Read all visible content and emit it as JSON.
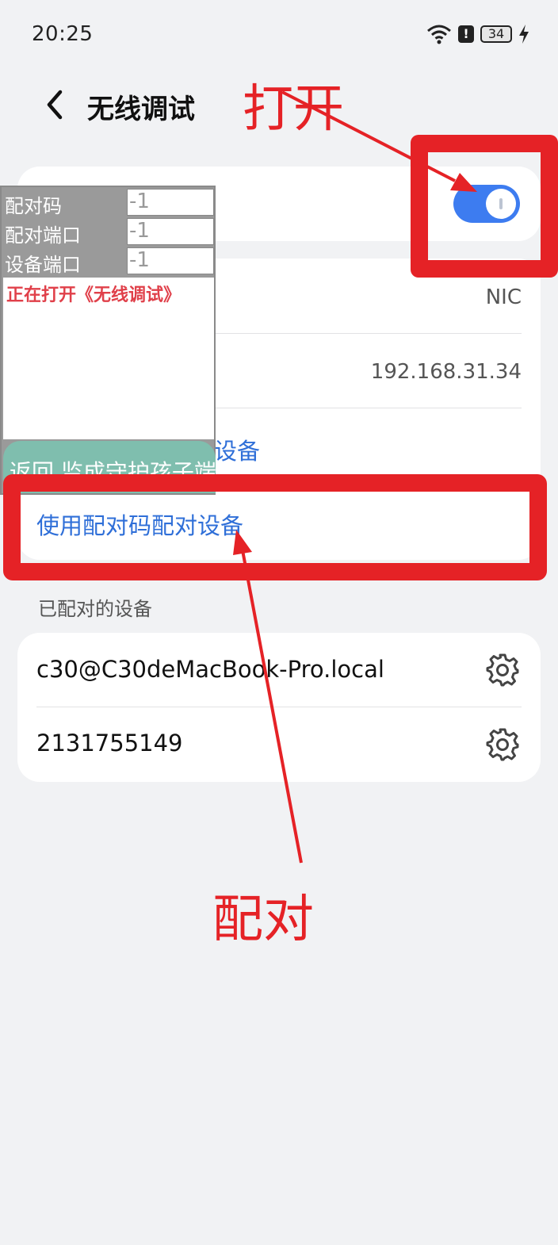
{
  "status_bar": {
    "time": "20:25",
    "battery": "34",
    "icons": [
      "wifi-icon",
      "alert-icon",
      "battery-icon",
      "charging-icon"
    ]
  },
  "header": {
    "title": "无线调试",
    "back_icon": "chevron-left-icon"
  },
  "toggle": {
    "state": "on",
    "accent": "#3d7cf0"
  },
  "info_rows": [
    {
      "value": "NIC"
    },
    {
      "value": "192.168.31.34"
    }
  ],
  "info_links": [
    {
      "label": "设备"
    },
    {
      "label": "使用配对码配对设备"
    }
  ],
  "paired_section": {
    "label": "已配对的设备",
    "devices": [
      {
        "name": "c30@C30deMacBook-Pro.local",
        "icon": "gear-icon"
      },
      {
        "name": "2131755149",
        "icon": "gear-icon"
      }
    ]
  },
  "overlay": {
    "fields": [
      {
        "label": "配对码",
        "value": "-1"
      },
      {
        "label": "配对端口",
        "value": "-1"
      },
      {
        "label": "设备端口",
        "value": "-1"
      }
    ],
    "log": "正在打开《无线调试》",
    "button": "返回 监成守护孩子端"
  },
  "annotations": {
    "open_label": "打开",
    "pair_label": "配对",
    "color": "#e52226"
  }
}
